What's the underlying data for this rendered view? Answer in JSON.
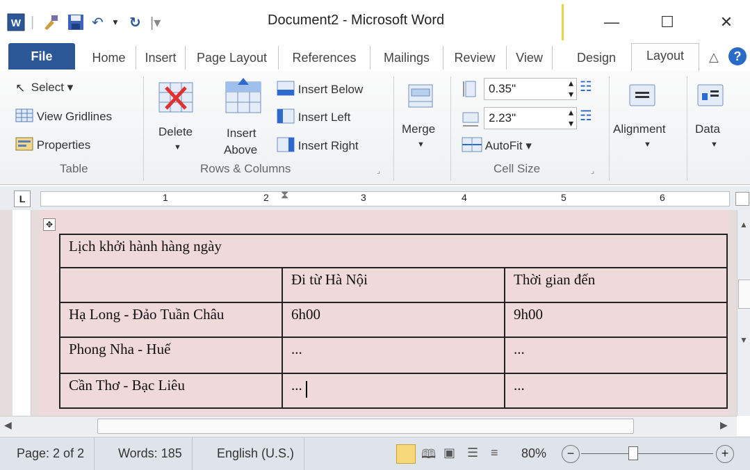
{
  "window": {
    "title": "Document2 - Microsoft Word",
    "minimize": "—",
    "maximize": "☐",
    "close": "✕"
  },
  "quick_access": {
    "save_icon": "save-icon",
    "undo_icon": "undo-icon",
    "redo_icon": "redo-icon"
  },
  "tabs": {
    "file": "File",
    "home": "Home",
    "insert": "Insert",
    "page_layout": "Page Layout",
    "references": "References",
    "mailings": "Mailings",
    "review": "Review",
    "view": "View",
    "design": "Design",
    "layout": "Layout"
  },
  "ribbon": {
    "table": {
      "select": "Select ▾",
      "view_gridlines": "View Gridlines",
      "properties": "Properties",
      "group_label": "Table"
    },
    "rows_columns": {
      "delete": "Delete",
      "insert_above_1": "Insert",
      "insert_above_2": "Above",
      "insert_below": "Insert Below",
      "insert_left": "Insert Left",
      "insert_right": "Insert Right",
      "group_label": "Rows & Columns"
    },
    "merge": {
      "label": "Merge"
    },
    "cell_size": {
      "height": "0.35\"",
      "width": "2.23\"",
      "autofit": "AutoFit ▾",
      "group_label": "Cell Size"
    },
    "alignment": {
      "label": "Alignment"
    },
    "data": {
      "label": "Data"
    }
  },
  "ruler": {
    "tab_selector": "L",
    "marks": [
      "1",
      "2",
      "3",
      "4",
      "5",
      "6"
    ]
  },
  "document": {
    "table": {
      "title_row": "Lịch khởi hành hàng ngày",
      "header": [
        "",
        "Đi từ Hà Nội",
        "Thời gian đến"
      ],
      "rows": [
        [
          "Hạ Long - Đảo Tuần Châu",
          "6h00",
          "9h00"
        ],
        [
          "Phong Nha - Huế",
          "...",
          "..."
        ],
        [
          "Cần Thơ - Bạc Liêu",
          "...",
          "..."
        ]
      ]
    }
  },
  "status_bar": {
    "page": "Page: 2 of 2",
    "words": "Words: 185",
    "language": "English (U.S.)",
    "zoom": "80%",
    "zoom_out": "−",
    "zoom_in": "+"
  },
  "colors": {
    "file_tab": "#2b5797",
    "page_bg": "#efd9db",
    "status_bg": "#dfe4ea"
  }
}
